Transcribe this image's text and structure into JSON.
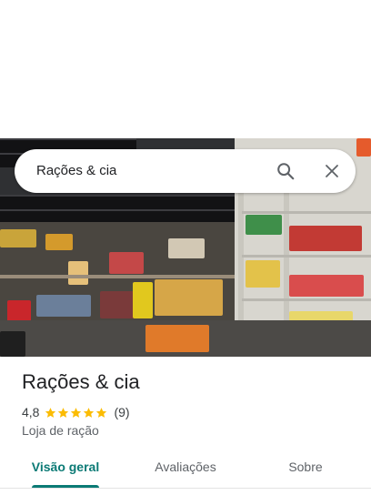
{
  "search": {
    "query": "Rações & cia",
    "search_icon": "search-icon",
    "clear_icon": "close-icon"
  },
  "place": {
    "name": "Rações & cia",
    "rating": "4,8",
    "rating_stars": 5,
    "reviews_count": "(9)",
    "category": "Loja de ração"
  },
  "tabs": [
    {
      "label": "Visão geral",
      "active": true
    },
    {
      "label": "Avaliações",
      "active": false
    },
    {
      "label": "Sobre",
      "active": false
    }
  ],
  "colors": {
    "accent": "#0b7a75",
    "star": "#fbbc04",
    "text_primary": "#202124",
    "text_secondary": "#5f6368"
  }
}
